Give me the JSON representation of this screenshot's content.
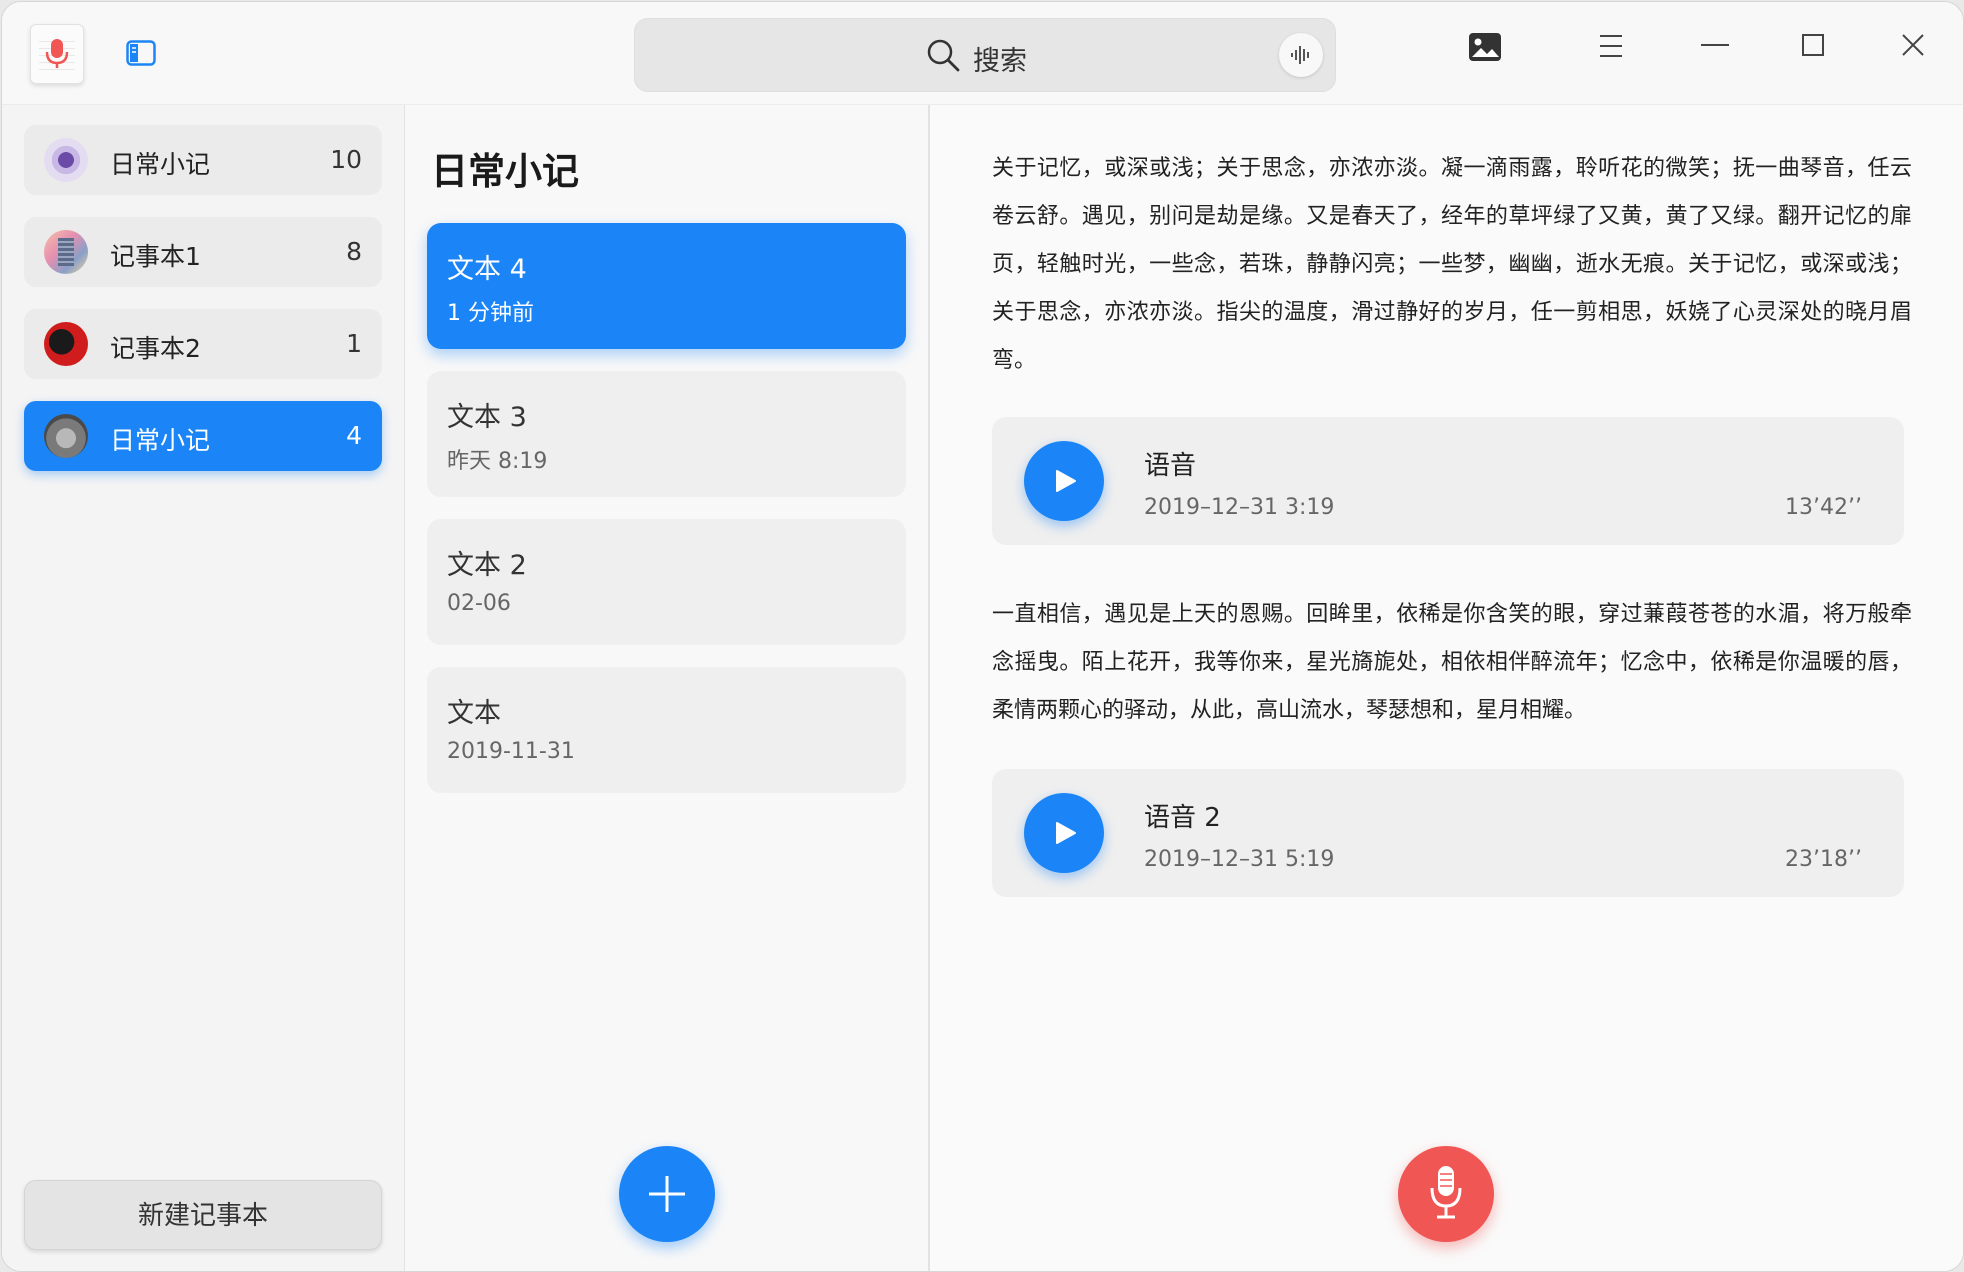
{
  "search": {
    "label": "搜索"
  },
  "notebooks": [
    {
      "name": "日常小记",
      "count": "10",
      "avatar": "purple-flower-icon"
    },
    {
      "name": "记事本1",
      "count": "8",
      "avatar": "building-icon"
    },
    {
      "name": "记事本2",
      "count": "1",
      "avatar": "red-dog-icon"
    },
    {
      "name": "日常小记",
      "count": "4",
      "avatar": "cat-icon"
    }
  ],
  "new_notebook_label": "新建记事本",
  "notes_panel": {
    "title": "日常小记",
    "notes": [
      {
        "title": "文本 4",
        "time": "1 分钟前"
      },
      {
        "title": "文本 3",
        "time": "昨天  8:19"
      },
      {
        "title": "文本 2",
        "time": "02-06"
      },
      {
        "title": "文本",
        "time": "2019-11-31"
      }
    ]
  },
  "editor": {
    "paragraph1": "关于记忆，或深或浅；关于思念，亦浓亦淡。凝一滴雨露，聆听花的微笑；抚一曲琴音，任云卷云舒。遇见，别问是劫是缘。又是春天了，经年的草坪绿了又黄，黄了又绿。翻开记忆的扉页，轻触时光，一些念，若珠，静静闪亮；一些梦，幽幽，逝水无痕。关于记忆，或深或浅；关于思念，亦浓亦淡。指尖的温度，滑过静好的岁月，任一剪相思，妖娆了心灵深处的晓月眉弯。",
    "voice1": {
      "title": "语音",
      "date": "2019–12–31   3:19",
      "duration": "13’42’’"
    },
    "paragraph2": "一直相信，遇见是上天的恩赐。回眸里，依稀是你含笑的眼，穿过蒹葭苍苍的水湄，将万般牵念摇曳。陌上花开，我等你来，星光旖旎处，相依相伴醉流年；忆念中，依稀是你温暖的唇，柔情两颗心的驿动，从此，高山流水，琴瑟想和，星月相耀。",
    "voice2": {
      "title": "语音 2",
      "date": "2019–12–31   5:19",
      "duration": "23’18’’"
    }
  },
  "colors": {
    "accent": "#1b85f7",
    "record": "#f05654"
  }
}
